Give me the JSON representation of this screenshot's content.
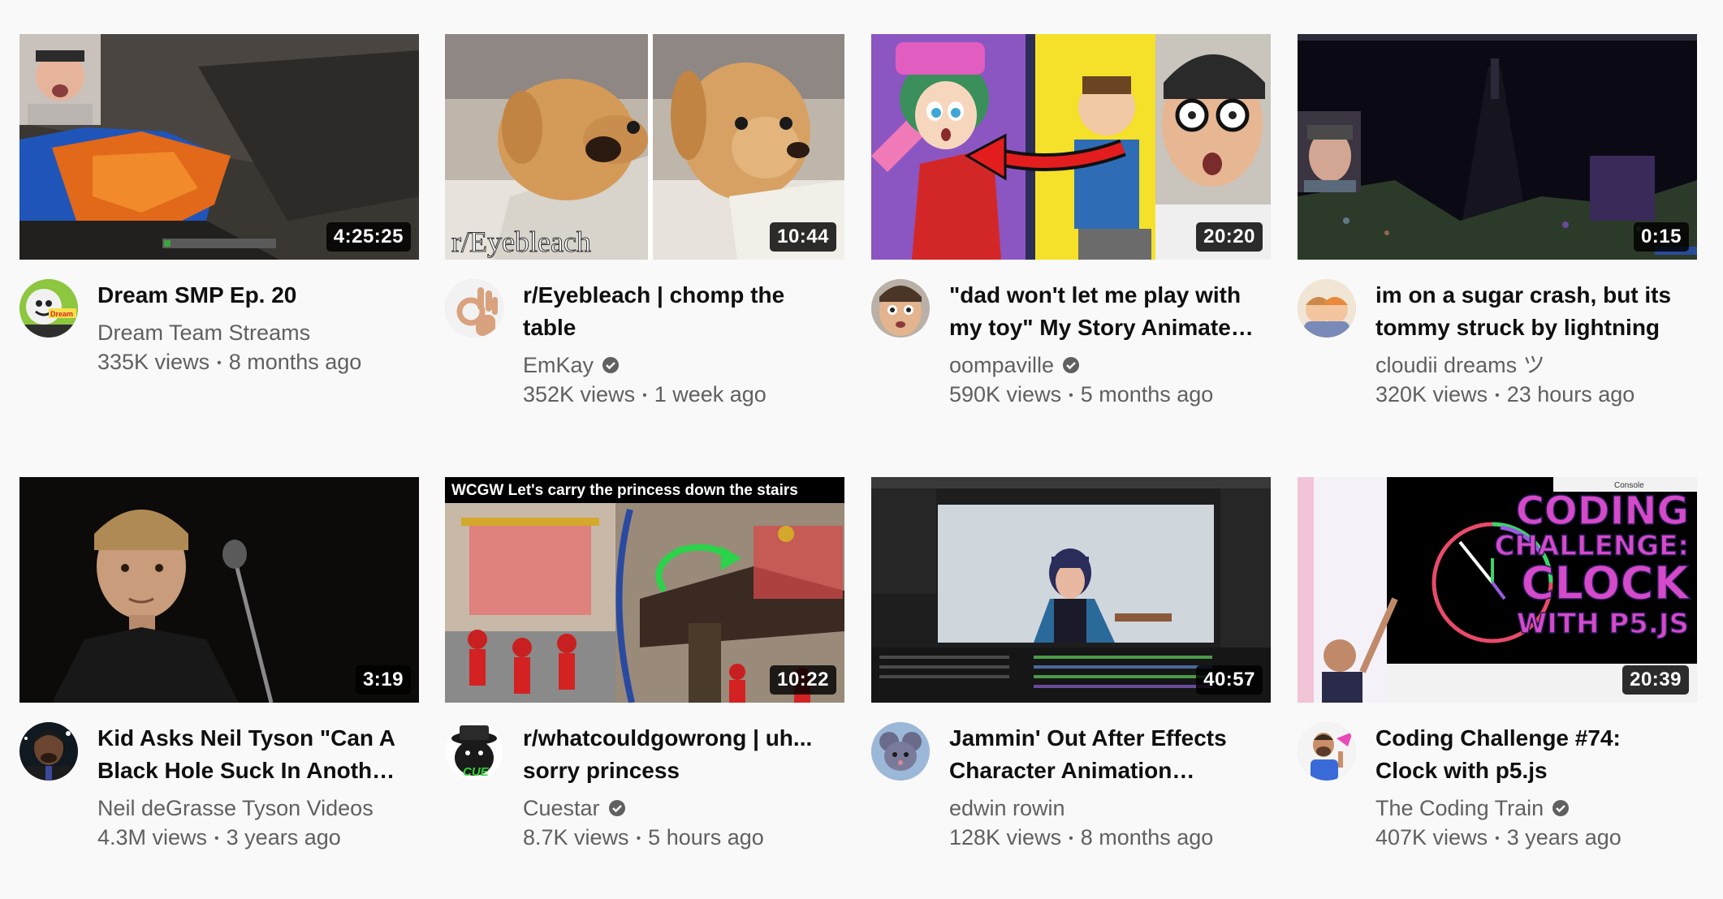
{
  "videos": [
    {
      "title": "Dream SMP Ep. 20",
      "channel": "Dream Team Streams",
      "verified": false,
      "views": "335K views",
      "age": "8 months ago",
      "duration": "4:25:25",
      "avatar": "dream-avatar-icon",
      "avatar_text": "Dream"
    },
    {
      "title": "r/Eyebleach | chomp the table",
      "channel": "EmKay",
      "verified": true,
      "views": "352K views",
      "age": "1 week ago",
      "duration": "10:44",
      "avatar": "ok-hand-avatar-icon",
      "thumb_text": "r/Eyebleach"
    },
    {
      "title": "\"dad won't let me play with my toy\" My Story Animate…",
      "channel": "oompaville",
      "verified": true,
      "views": "590K views",
      "age": "5 months ago",
      "duration": "20:20",
      "avatar": "face-avatar-icon"
    },
    {
      "title": "im on a sugar crash, but its tommy struck by lightning",
      "channel": "cloudii dreams ツ",
      "verified": false,
      "views": "320K views",
      "age": "23 hours ago",
      "duration": "0:15",
      "avatar": "cartoon-avatar-icon"
    },
    {
      "title": "Kid Asks Neil Tyson \"Can A Black Hole Suck In Anoth…",
      "channel": "Neil deGrasse Tyson Videos",
      "verified": false,
      "views": "4.3M views",
      "age": "3 years ago",
      "duration": "3:19",
      "avatar": "neil-avatar-icon"
    },
    {
      "title": "r/whatcouldgowrong | uh... sorry princess",
      "channel": "Cuestar",
      "verified": true,
      "views": "8.7K views",
      "age": "5 hours ago",
      "duration": "10:22",
      "avatar": "cuestar-avatar-icon",
      "avatar_text": "CUE",
      "thumb_text": "WCGW Let's carry the princess down the stairs"
    },
    {
      "title": "Jammin' Out After Effects Character Animation…",
      "channel": "edwin rowin",
      "verified": false,
      "views": "128K views",
      "age": "8 months ago",
      "duration": "40:57",
      "avatar": "mouse-avatar-icon"
    },
    {
      "title": "Coding Challenge #74: Clock with p5.js",
      "channel": "The Coding Train",
      "verified": true,
      "views": "407K views",
      "age": "3 years ago",
      "duration": "20:39",
      "avatar": "coding-train-avatar-icon",
      "thumb_lines": [
        "CODING",
        "CHALLENGE:",
        "CLOCK",
        "WITH P5.JS"
      ],
      "thumb_console": "Console"
    }
  ],
  "separator": "•",
  "colors": {
    "title": "#0f0f0f",
    "secondary": "#606060",
    "background": "#f9f9f9",
    "duration_bg": "#000000"
  }
}
